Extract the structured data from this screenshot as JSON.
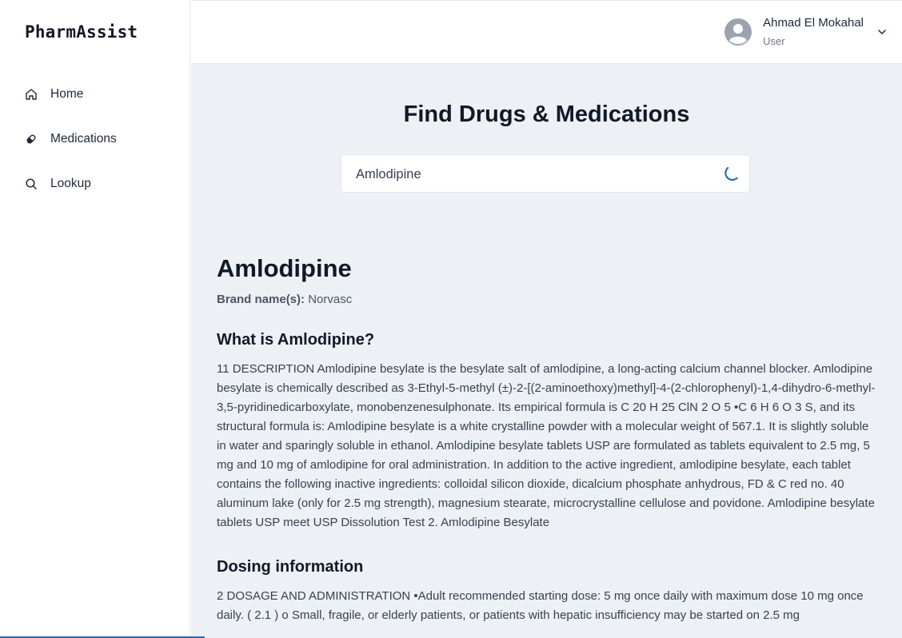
{
  "app": {
    "logo": "PharmAssist"
  },
  "sidebar": {
    "items": [
      {
        "label": "Home",
        "icon": "home-icon"
      },
      {
        "label": "Medications",
        "icon": "pill-icon"
      },
      {
        "label": "Lookup",
        "icon": "search-icon"
      }
    ]
  },
  "header": {
    "user": {
      "name": "Ahmad El Mokahal",
      "role": "User",
      "icon": "user-circle-icon"
    }
  },
  "main": {
    "title": "Find Drugs & Medications",
    "search": {
      "value": "Amlodipine",
      "loading": true
    },
    "drug": {
      "name": "Amlodipine",
      "brand_label": "Brand name(s):",
      "brand_value": "Norvasc",
      "what_title": "What is Amlodipine?",
      "what_text": "11 DESCRIPTION Amlodipine besylate is the besylate salt of amlodipine, a long-acting calcium channel blocker. Amlodipine besylate is chemically described as 3-Ethyl-5-methyl (±)-2-[(2-aminoethoxy)methyl]-4-(2-chlorophenyl)-1,4-dihydro-6-methyl-3,5-pyridinedicarboxylate, monobenzenesulphonate. Its empirical formula is C 20 H 25 ClN 2 O 5 •C 6 H 6 O 3 S, and its structural formula is: Amlodipine besylate is a white crystalline powder with a molecular weight of 567.1. It is slightly soluble in water and sparingly soluble in ethanol. Amlodipine besylate tablets USP are formulated as tablets equivalent to 2.5 mg, 5 mg and 10 mg of amlodipine for oral administration. In addition to the active ingredient, amlodipine besylate, each tablet contains the following inactive ingredients: colloidal silicon dioxide, dicalcium phosphate anhydrous, FD & C red no. 40 aluminum lake (only for 2.5 mg strength), magnesium stearate, microcrystalline cellulose and povidone. Amlodipine besylate tablets USP meet USP Dissolution Test 2. Amlodipine Besylate",
      "dosing_title": "Dosing information",
      "dosing_text": "2 DOSAGE AND ADMINISTRATION •Adult recommended starting dose: 5 mg once daily with maximum dose 10 mg once daily. ( 2.1 ) o Small, fragile, or elderly patients, or patients with hepatic insufficiency may be started on 2.5 mg"
    }
  },
  "colors": {
    "sidebar_bg": "#ffffff",
    "main_bg": "#edf1f5",
    "spinner": "#2b6cb0",
    "text_dark": "#111827"
  }
}
